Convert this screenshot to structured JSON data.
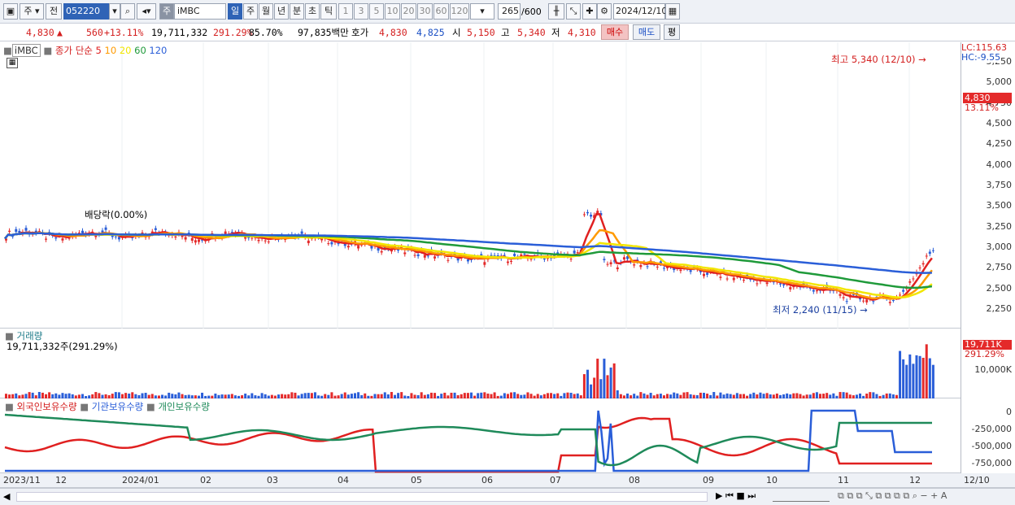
{
  "toolbar": {
    "market": "주",
    "prev": "전",
    "code": "052220",
    "name": "iMBC",
    "stock_tag": "주",
    "periods": [
      "일",
      "주",
      "월",
      "년",
      "분",
      "초",
      "틱"
    ],
    "nums": [
      "1",
      "3",
      "5",
      "10",
      "20",
      "30",
      "60",
      "120"
    ],
    "count": "265",
    "total": "/600",
    "date": "2024/12/10"
  },
  "quote": {
    "price": "4,830",
    "arrow": "▲",
    "change": "560",
    "pct": "+13.11%",
    "volume": "19,711,332",
    "vol_pct": "291.29%",
    "ratio": "85.70%",
    "amount": "97,835백만",
    "bid_label": "호가",
    "bid1": "4,830",
    "bid2": "4,825",
    "open_label": "시",
    "open": "5,150",
    "high_label": "고",
    "high": "5,340",
    "low_label": "저",
    "low": "4,310",
    "buy": "매수",
    "sell": "매도",
    "eval": "평"
  },
  "price_panel": {
    "legend_name": "iMBC",
    "legend_ma": "종가 단순",
    "ma": [
      "5",
      "10",
      "20",
      "60",
      "120"
    ],
    "ma_colors": [
      "#e02020",
      "#ff9a00",
      "#f2e600",
      "#1f9a3a",
      "#2a5ed8"
    ],
    "high_note": "최고 5,340 (12/10)",
    "low_note": "최저 2,240 (11/15)",
    "dividend": "배당락(0.00%)",
    "lc": "LC:115.63",
    "hc": "HC:-9.55",
    "cur_price": "4,830",
    "cur_pct": "13.11%",
    "yticks": [
      "5,250",
      "5,000",
      "4,750",
      "4,500",
      "4,250",
      "4,000",
      "3,750",
      "3,500",
      "3,250",
      "3,000",
      "2,750",
      "2,500",
      "2,250"
    ]
  },
  "volume_panel": {
    "title": "거래량",
    "value": "19,711,332주(291.29%)",
    "box": "19,711K",
    "pct": "291.29%",
    "ytick": "10,000K"
  },
  "holding_panel": {
    "foreign": "외국인보유수량",
    "inst": "기관보유수량",
    "retail": "개인보유수량",
    "yticks": [
      "0",
      "-250,000",
      "-500,000",
      "-750,000"
    ]
  },
  "xaxis": [
    "2023/11",
    "12",
    "2024/01",
    "02",
    "03",
    "04",
    "05",
    "06",
    "07",
    "08",
    "09",
    "10",
    "11",
    "12",
    "12/10"
  ]
}
